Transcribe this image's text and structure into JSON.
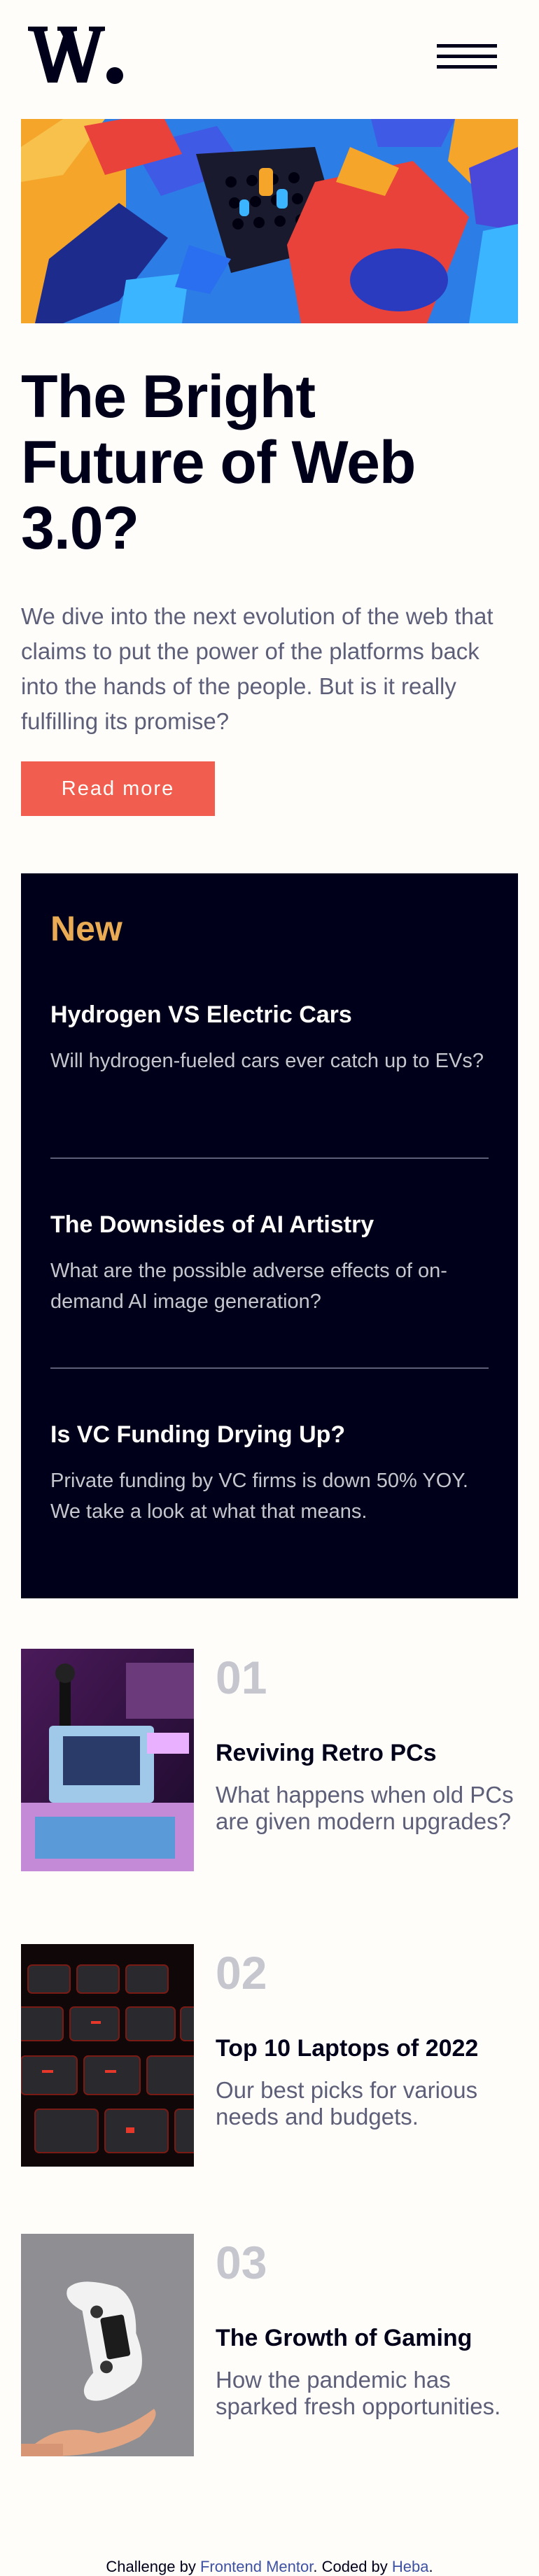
{
  "header": {
    "logo_label": "W.",
    "menu_icon": "hamburger-menu-icon"
  },
  "hero": {
    "image_icon": "abstract-3d-shapes-image",
    "title_line1": "The Bright",
    "title_line2": "Future of Web",
    "title_line3": "3.0?",
    "description": "We dive into the next evolution of the web that claims to put the power of the platforms back into the hands of the people. But is it really fulfilling its promise?",
    "button_label": "Read more"
  },
  "new": {
    "heading": "New",
    "items": [
      {
        "title": "Hydrogen VS Electric Cars",
        "desc": "Will hydrogen-fueled cars ever catch up to EVs?"
      },
      {
        "title": "The Downsides of AI Artistry",
        "desc": "What are the possible adverse effects of on-demand AI image generation?"
      },
      {
        "title": "Is VC Funding Drying Up?",
        "desc": "Private funding by VC firms is down 50% YOY. We take a look at what that means."
      }
    ]
  },
  "articles": [
    {
      "number": "01",
      "title": "Reviving Retro PCs",
      "desc": "What happens when old PCs are given modern upgrades?",
      "thumb": "retro-pc-image"
    },
    {
      "number": "02",
      "title": "Top 10 Laptops of 2022",
      "desc": "Our best picks for various needs and budgets.",
      "thumb": "laptop-keyboard-image"
    },
    {
      "number": "03",
      "title": "The Growth of Gaming",
      "desc": "How the pandemic has sparked fresh opportunities.",
      "thumb": "gamepad-image"
    }
  ],
  "footer": {
    "prefix": "Challenge by ",
    "link1": "Frontend Mentor",
    "middle": ". Coded by ",
    "link2": "Heba",
    "suffix": "."
  },
  "colors": {
    "background": "#fffdfa",
    "dark": "#00001a",
    "accent_red": "#f15e50",
    "accent_orange": "#e9ab53",
    "grayish_blue": "#5d5f79"
  }
}
